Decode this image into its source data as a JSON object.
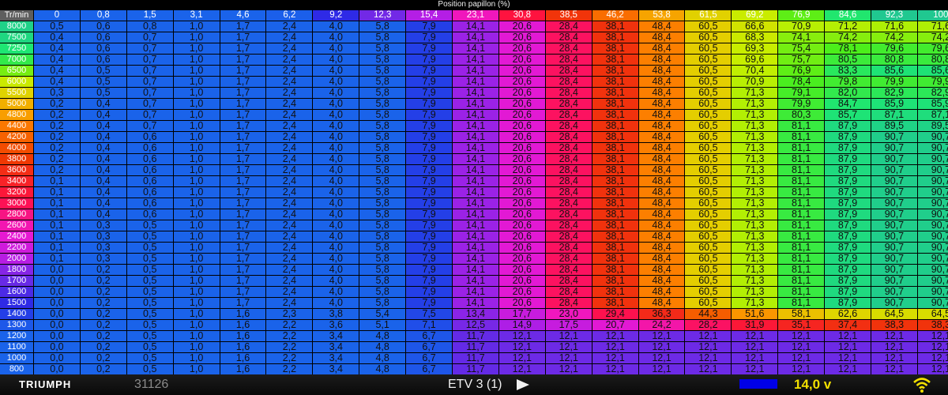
{
  "map": {
    "title": "Position papillon (%)",
    "corner_label": "Tr/min",
    "throttle_axis": [
      "0",
      "0,8",
      "1,5",
      "3,1",
      "4,6",
      "6,2",
      "9,2",
      "12,3",
      "15,4",
      "23,1",
      "30,8",
      "38,5",
      "46,2",
      "53,8",
      "61,5",
      "69,2",
      "76,9",
      "84,6",
      "92,3",
      "100"
    ],
    "rpm_axis": [
      "8000",
      "7500",
      "7250",
      "7000",
      "6500",
      "6000",
      "5500",
      "5000",
      "4800",
      "4400",
      "4200",
      "4000",
      "3800",
      "3600",
      "3400",
      "3200",
      "3000",
      "2800",
      "2600",
      "2400",
      "2200",
      "2000",
      "1800",
      "1700",
      "1600",
      "1500",
      "1400",
      "1300",
      "1200",
      "1100",
      "1000",
      "800"
    ],
    "rows": [
      [
        "0,5",
        "0,6",
        "0,8",
        "1,0",
        "1,7",
        "2,4",
        "4,0",
        "5,8",
        "7,9",
        "14,1",
        "20,6",
        "28,4",
        "38,1",
        "48,4",
        "60,5",
        "66,6",
        "70,9",
        "71,2",
        "71,6",
        "71,6"
      ],
      [
        "0,4",
        "0,6",
        "0,7",
        "1,0",
        "1,7",
        "2,4",
        "4,0",
        "5,8",
        "7,9",
        "14,1",
        "20,6",
        "28,4",
        "38,1",
        "48,4",
        "60,5",
        "68,3",
        "74,1",
        "74,2",
        "74,2",
        "74,2"
      ],
      [
        "0,4",
        "0,6",
        "0,7",
        "1,0",
        "1,7",
        "2,4",
        "4,0",
        "5,8",
        "7,9",
        "14,1",
        "20,6",
        "28,4",
        "38,1",
        "48,4",
        "60,5",
        "69,3",
        "75,4",
        "78,1",
        "79,6",
        "79,6"
      ],
      [
        "0,4",
        "0,6",
        "0,7",
        "1,0",
        "1,7",
        "2,4",
        "4,0",
        "5,8",
        "7,9",
        "14,1",
        "20,6",
        "28,4",
        "38,1",
        "48,4",
        "60,5",
        "69,6",
        "75,7",
        "80,5",
        "80,8",
        "80,8"
      ],
      [
        "0,4",
        "0,5",
        "0,7",
        "1,0",
        "1,7",
        "2,4",
        "4,0",
        "5,8",
        "7,9",
        "14,1",
        "20,6",
        "28,4",
        "38,1",
        "48,4",
        "60,5",
        "70,4",
        "76,9",
        "83,3",
        "85,6",
        "85,6"
      ],
      [
        "0,4",
        "0,5",
        "0,7",
        "1,0",
        "1,7",
        "2,4",
        "4,0",
        "5,8",
        "7,9",
        "14,1",
        "20,6",
        "28,4",
        "38,1",
        "48,4",
        "60,5",
        "70,9",
        "78,4",
        "79,8",
        "79,9",
        "79,9"
      ],
      [
        "0,3",
        "0,5",
        "0,7",
        "1,0",
        "1,7",
        "2,4",
        "4,0",
        "5,8",
        "7,9",
        "14,1",
        "20,6",
        "28,4",
        "38,1",
        "48,4",
        "60,5",
        "71,3",
        "79,1",
        "82,0",
        "82,9",
        "82,9"
      ],
      [
        "0,2",
        "0,4",
        "0,7",
        "1,0",
        "1,7",
        "2,4",
        "4,0",
        "5,8",
        "7,9",
        "14,1",
        "20,6",
        "28,4",
        "38,1",
        "48,4",
        "60,5",
        "71,3",
        "79,9",
        "84,7",
        "85,9",
        "85,9"
      ],
      [
        "0,2",
        "0,4",
        "0,7",
        "1,0",
        "1,7",
        "2,4",
        "4,0",
        "5,8",
        "7,9",
        "14,1",
        "20,6",
        "28,4",
        "38,1",
        "48,4",
        "60,5",
        "71,3",
        "80,3",
        "85,7",
        "87,1",
        "87,1"
      ],
      [
        "0,2",
        "0,4",
        "0,7",
        "1,0",
        "1,7",
        "2,4",
        "4,0",
        "5,8",
        "7,9",
        "14,1",
        "20,6",
        "28,4",
        "38,1",
        "48,4",
        "60,5",
        "71,3",
        "81,1",
        "87,9",
        "89,5",
        "89,5"
      ],
      [
        "0,2",
        "0,4",
        "0,6",
        "1,0",
        "1,7",
        "2,4",
        "4,0",
        "5,8",
        "7,9",
        "14,1",
        "20,6",
        "28,4",
        "38,1",
        "48,4",
        "60,5",
        "71,3",
        "81,1",
        "87,9",
        "90,7",
        "90,7"
      ],
      [
        "0,2",
        "0,4",
        "0,6",
        "1,0",
        "1,7",
        "2,4",
        "4,0",
        "5,8",
        "7,9",
        "14,1",
        "20,6",
        "28,4",
        "38,1",
        "48,4",
        "60,5",
        "71,3",
        "81,1",
        "87,9",
        "90,7",
        "90,7"
      ],
      [
        "0,2",
        "0,4",
        "0,6",
        "1,0",
        "1,7",
        "2,4",
        "4,0",
        "5,8",
        "7,9",
        "14,1",
        "20,6",
        "28,4",
        "38,1",
        "48,4",
        "60,5",
        "71,3",
        "81,1",
        "87,9",
        "90,7",
        "90,7"
      ],
      [
        "0,2",
        "0,4",
        "0,6",
        "1,0",
        "1,7",
        "2,4",
        "4,0",
        "5,8",
        "7,9",
        "14,1",
        "20,6",
        "28,4",
        "38,1",
        "48,4",
        "60,5",
        "71,3",
        "81,1",
        "87,9",
        "90,7",
        "90,7"
      ],
      [
        "0,1",
        "0,4",
        "0,6",
        "1,0",
        "1,7",
        "2,4",
        "4,0",
        "5,8",
        "7,9",
        "14,1",
        "20,6",
        "28,4",
        "38,1",
        "48,4",
        "60,5",
        "71,3",
        "81,1",
        "87,9",
        "90,7",
        "90,7"
      ],
      [
        "0,1",
        "0,4",
        "0,6",
        "1,0",
        "1,7",
        "2,4",
        "4,0",
        "5,8",
        "7,9",
        "14,1",
        "20,6",
        "28,4",
        "38,1",
        "48,4",
        "60,5",
        "71,3",
        "81,1",
        "87,9",
        "90,7",
        "90,7"
      ],
      [
        "0,1",
        "0,4",
        "0,6",
        "1,0",
        "1,7",
        "2,4",
        "4,0",
        "5,8",
        "7,9",
        "14,1",
        "20,6",
        "28,4",
        "38,1",
        "48,4",
        "60,5",
        "71,3",
        "81,1",
        "87,9",
        "90,7",
        "90,7"
      ],
      [
        "0,1",
        "0,4",
        "0,6",
        "1,0",
        "1,7",
        "2,4",
        "4,0",
        "5,8",
        "7,9",
        "14,1",
        "20,6",
        "28,4",
        "38,1",
        "48,4",
        "60,5",
        "71,3",
        "81,1",
        "87,9",
        "90,7",
        "90,7"
      ],
      [
        "0,1",
        "0,3",
        "0,5",
        "1,0",
        "1,7",
        "2,4",
        "4,0",
        "5,8",
        "7,9",
        "14,1",
        "20,6",
        "28,4",
        "38,1",
        "48,4",
        "60,5",
        "71,3",
        "81,1",
        "87,9",
        "90,7",
        "90,7"
      ],
      [
        "0,1",
        "0,3",
        "0,5",
        "1,0",
        "1,7",
        "2,4",
        "4,0",
        "5,8",
        "7,9",
        "14,1",
        "20,6",
        "28,4",
        "38,1",
        "48,4",
        "60,5",
        "71,3",
        "81,1",
        "87,9",
        "90,7",
        "90,7"
      ],
      [
        "0,1",
        "0,3",
        "0,5",
        "1,0",
        "1,7",
        "2,4",
        "4,0",
        "5,8",
        "7,9",
        "14,1",
        "20,6",
        "28,4",
        "38,1",
        "48,4",
        "60,5",
        "71,3",
        "81,1",
        "87,9",
        "90,7",
        "90,7"
      ],
      [
        "0,1",
        "0,3",
        "0,5",
        "1,0",
        "1,7",
        "2,4",
        "4,0",
        "5,8",
        "7,9",
        "14,1",
        "20,6",
        "28,4",
        "38,1",
        "48,4",
        "60,5",
        "71,3",
        "81,1",
        "87,9",
        "90,7",
        "90,7"
      ],
      [
        "0,0",
        "0,2",
        "0,5",
        "1,0",
        "1,7",
        "2,4",
        "4,0",
        "5,8",
        "7,9",
        "14,1",
        "20,6",
        "28,4",
        "38,1",
        "48,4",
        "60,5",
        "71,3",
        "81,1",
        "87,9",
        "90,7",
        "90,7"
      ],
      [
        "0,0",
        "0,2",
        "0,5",
        "1,0",
        "1,7",
        "2,4",
        "4,0",
        "5,8",
        "7,9",
        "14,1",
        "20,6",
        "28,4",
        "38,1",
        "48,4",
        "60,5",
        "71,3",
        "81,1",
        "87,9",
        "90,7",
        "90,7"
      ],
      [
        "0,0",
        "0,2",
        "0,5",
        "1,0",
        "1,7",
        "2,4",
        "4,0",
        "5,8",
        "7,9",
        "14,1",
        "20,6",
        "28,4",
        "38,1",
        "48,4",
        "60,5",
        "71,3",
        "81,1",
        "87,9",
        "90,7",
        "90,7"
      ],
      [
        "0,0",
        "0,2",
        "0,5",
        "1,0",
        "1,7",
        "2,4",
        "4,0",
        "5,8",
        "7,9",
        "14,1",
        "20,6",
        "28,4",
        "38,1",
        "48,4",
        "60,5",
        "71,3",
        "81,1",
        "87,9",
        "90,7",
        "90,7"
      ],
      [
        "0,0",
        "0,2",
        "0,5",
        "1,0",
        "1,6",
        "2,3",
        "3,8",
        "5,4",
        "7,5",
        "13,4",
        "17,7",
        "23,0",
        "29,4",
        "36,3",
        "44,3",
        "51,6",
        "58,1",
        "62,6",
        "64,5",
        "64,5"
      ],
      [
        "0,0",
        "0,2",
        "0,5",
        "1,0",
        "1,6",
        "2,2",
        "3,6",
        "5,1",
        "7,1",
        "12,5",
        "14,9",
        "17,5",
        "20,7",
        "24,2",
        "28,2",
        "31,9",
        "35,1",
        "37,4",
        "38,3",
        "38,3"
      ],
      [
        "0,0",
        "0,2",
        "0,5",
        "1,0",
        "1,6",
        "2,2",
        "3,4",
        "4,8",
        "6,7",
        "11,7",
        "12,1",
        "12,1",
        "12,1",
        "12,1",
        "12,1",
        "12,1",
        "12,1",
        "12,1",
        "12,1",
        "12,1"
      ],
      [
        "0,0",
        "0,2",
        "0,5",
        "1,0",
        "1,6",
        "2,2",
        "3,4",
        "4,8",
        "6,7",
        "11,7",
        "12,1",
        "12,1",
        "12,1",
        "12,1",
        "12,1",
        "12,1",
        "12,1",
        "12,1",
        "12,1",
        "12,1"
      ],
      [
        "0,0",
        "0,2",
        "0,5",
        "1,0",
        "1,6",
        "2,2",
        "3,4",
        "4,8",
        "6,7",
        "11,7",
        "12,1",
        "12,1",
        "12,1",
        "12,1",
        "12,1",
        "12,1",
        "12,1",
        "12,1",
        "12,1",
        "12,1"
      ],
      [
        "0,0",
        "0,2",
        "0,5",
        "1,0",
        "1,6",
        "2,2",
        "3,4",
        "4,8",
        "6,7",
        "11,7",
        "12,1",
        "12,1",
        "12,1",
        "12,1",
        "12,1",
        "12,1",
        "12,1",
        "12,1",
        "12,1",
        "12,1"
      ]
    ]
  },
  "footer": {
    "brand": "TRIUMPH",
    "serial": "31126",
    "map_name": "ETV 3 (1)",
    "voltage": "14,0 v",
    "icons": {
      "play": "play-icon",
      "wifi": "wifi-icon"
    }
  },
  "colors": {
    "value_scale": [
      {
        "at": 0,
        "color": "#1a63ea"
      },
      {
        "at": 6,
        "color": "#1a63ea"
      },
      {
        "at": 9,
        "color": "#2a2ae6"
      },
      {
        "at": 12,
        "color": "#6b2ae6"
      },
      {
        "at": 15,
        "color": "#b01ee6"
      },
      {
        "at": 22,
        "color": "#ee18cf"
      },
      {
        "at": 30,
        "color": "#ff1044"
      },
      {
        "at": 40,
        "color": "#ee3a00"
      },
      {
        "at": 50,
        "color": "#ff8c00"
      },
      {
        "at": 60,
        "color": "#e6cc00"
      },
      {
        "at": 70,
        "color": "#c6ef00"
      },
      {
        "at": 78,
        "color": "#4dee1a"
      },
      {
        "at": 85,
        "color": "#1ee673"
      },
      {
        "at": 92,
        "color": "#20c890"
      }
    ]
  }
}
